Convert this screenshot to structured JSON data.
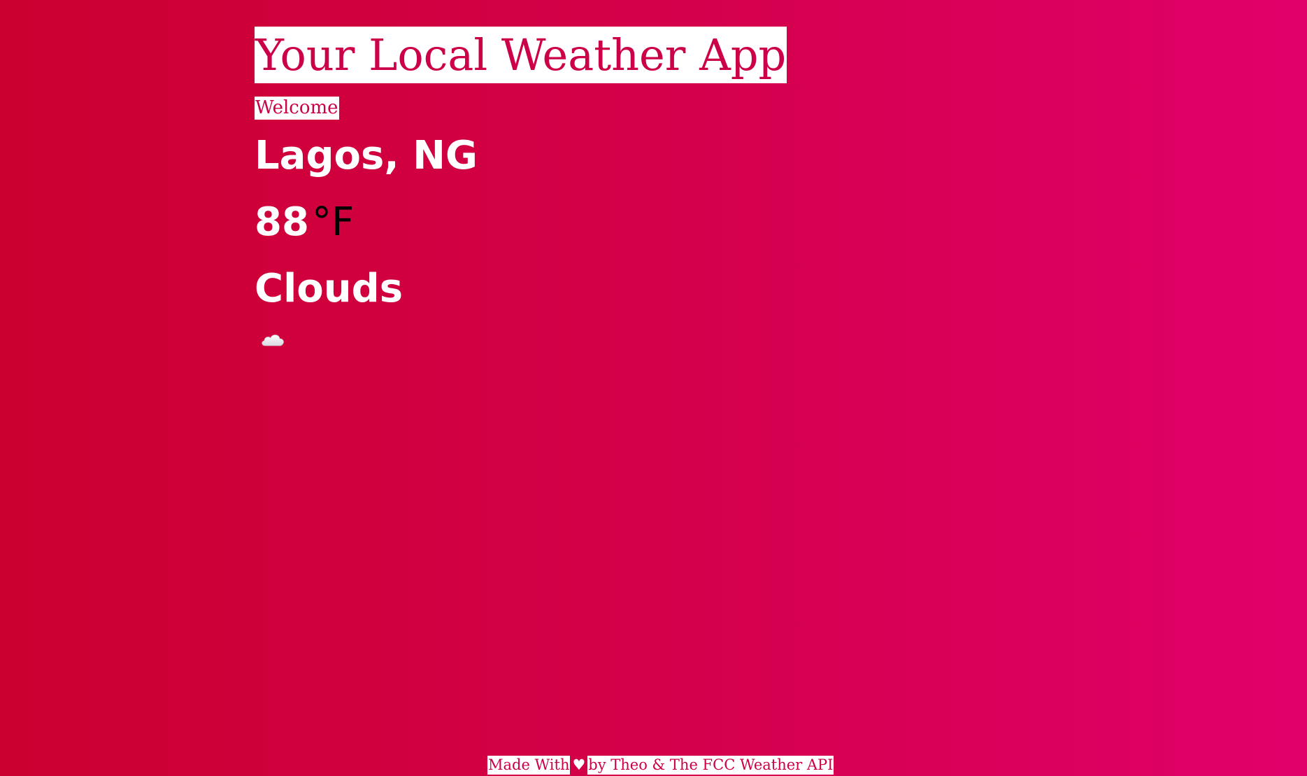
{
  "header": {
    "title": "Your Local Weather App",
    "welcome": "Welcome"
  },
  "weather": {
    "location": "Lagos, NG",
    "temperature": "88",
    "unit": "°F",
    "condition": "Clouds",
    "icon": "cloud-icon"
  },
  "footer": {
    "made_with": "Made With",
    "heart": "♥",
    "credit": "by Theo & The FCC Weather API"
  },
  "colors": {
    "background_start": "#cb0030",
    "background_end": "#e0006a",
    "accent": "#cc0048",
    "text_light": "#ffffff",
    "unit_text": "#000000"
  }
}
